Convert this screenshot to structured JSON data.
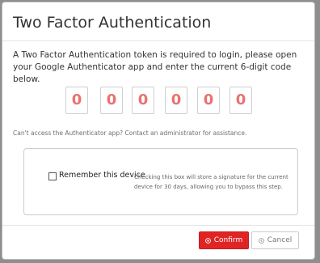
{
  "dialog": {
    "title": "Two Factor Authentication",
    "intro": "A Two Factor Authentication token is required to login, please open your Google Authenticator app and enter the current 6-digit code below.",
    "code_digits": [
      "0",
      "0",
      "0",
      "0",
      "0",
      "0"
    ],
    "help_text": "Can't access the Authenticator app? Contact an administrator for assistance.",
    "remember": {
      "label": "Remember this device",
      "description": "Checking this box will store a signature for the current device for 30 days, allowing you to bypass this step.",
      "checked": false
    },
    "buttons": {
      "confirm_label": "Confirm",
      "cancel_label": "Cancel"
    },
    "colors": {
      "confirm_bg": "#e02424",
      "digit_color": "#e8736f"
    },
    "icons": {
      "confirm": "check-circle-icon",
      "cancel": "back-circle-icon"
    }
  }
}
